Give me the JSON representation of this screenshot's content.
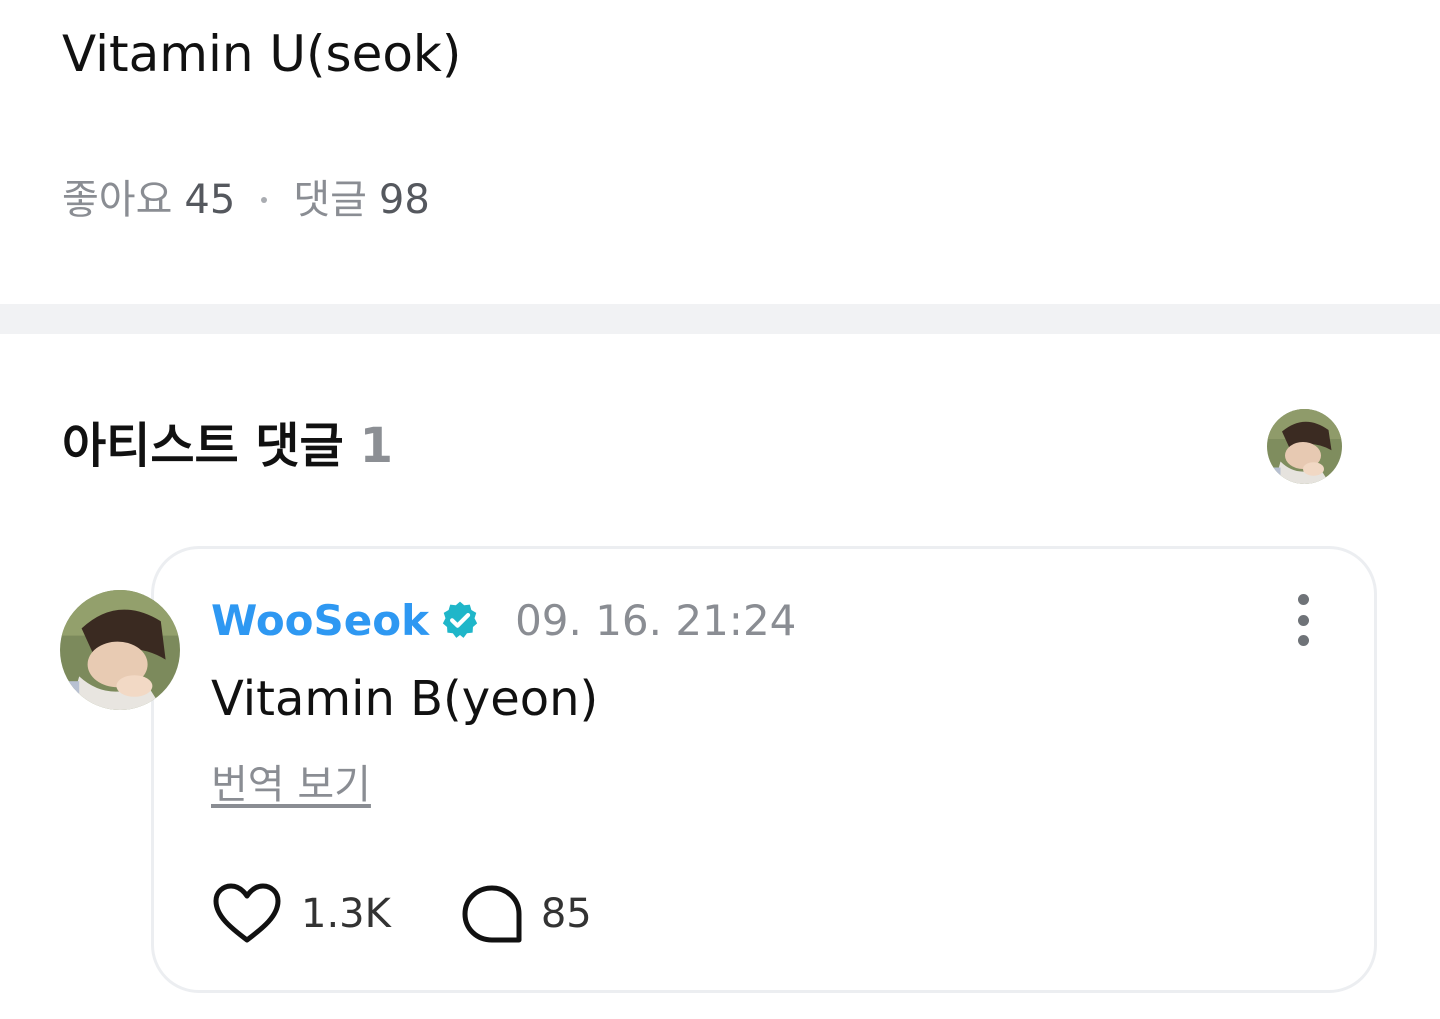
{
  "post": {
    "title": "Vitamin U(seok)",
    "likes_label": "좋아요",
    "likes_count": "45",
    "comments_label": "댓글",
    "comments_count": "98"
  },
  "artist_comments": {
    "header_label": "아티스트 댓글",
    "header_count": "1",
    "comment": {
      "author": "WooSeok",
      "verified": true,
      "timestamp": "09. 16. 21:24",
      "text": "Vitamin B(yeon)",
      "translate_label": "번역 보기",
      "like_count": "1.3K",
      "reply_count": "85"
    }
  },
  "colors": {
    "author_name": "#2e98f2",
    "verified_badge": "#1fb6c9",
    "muted_text": "#8a8d93",
    "divider": "#f1f2f4",
    "card_border": "#eceef1"
  },
  "icons": {
    "verified": "verified-badge-icon",
    "more": "more-vertical-icon",
    "like": "heart-icon",
    "reply": "comment-bubble-icon"
  }
}
